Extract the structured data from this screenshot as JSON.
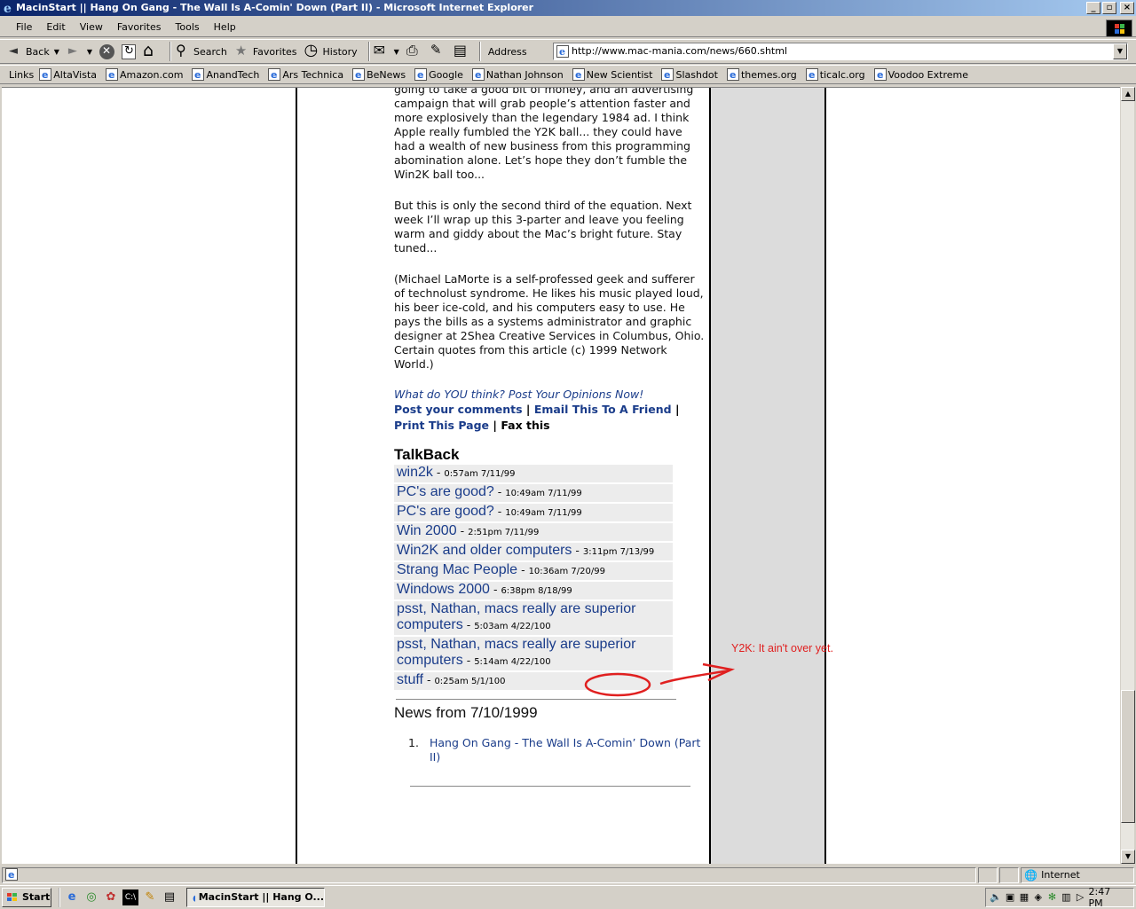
{
  "window": {
    "title": "MacinStart || Hang On Gang - The Wall Is A-Comin' Down (Part II) - Microsoft Internet Explorer"
  },
  "menu": [
    "File",
    "Edit",
    "View",
    "Favorites",
    "Tools",
    "Help"
  ],
  "toolbar": {
    "back": "Back",
    "search": "Search",
    "favorites": "Favorites",
    "history": "History",
    "address_label": "Address",
    "url": "http://www.mac-mania.com/news/660.shtml"
  },
  "links": {
    "label": "Links",
    "items": [
      "AltaVista",
      "Amazon.com",
      "AnandTech",
      "Ars Technica",
      "BeNews",
      "Google",
      "Nathan Johnson",
      "New Scientist",
      "Slashdot",
      "themes.org",
      "ticalc.org",
      "Voodoo Extreme"
    ]
  },
  "article": {
    "p1": "going to take a good bit of money, and an advertising campaign that will grab people’s attention faster and more explosively than the legendary 1984 ad. I think Apple really fumbled the Y2K ball... they could have had a wealth of new business from this programming abomination alone. Let’s hope they don’t fumble the Win2K ball too...",
    "p2": "But this is only the second third of the equation. Next week I’ll wrap up this 3-parter and leave you feeling warm and giddy about the Mac’s bright future. Stay tuned...",
    "p3": "(Michael LaMorte is a self-professed geek and sufferer of technolust syndrome. He likes his music played loud, his beer ice-cold, and his computers easy to use. He pays the bills as a systems administrator and graphic designer at 2Shea Creative Services in Columbus, Ohio. Certain quotes from this article (c) 1999 Network World.)",
    "opinions": "What do YOU think? Post Your Opinions Now!",
    "post_comments": "Post your comments",
    "email_friend": "Email This To A Friend",
    "print_page": "Print This Page",
    "fax": "Fax this",
    "sep": "|"
  },
  "talkback": {
    "title": "TalkBack",
    "dash": "-",
    "items": [
      {
        "title": "win2k",
        "date": "0:57am 7/11/99"
      },
      {
        "title": "PC's are good?",
        "date": "10:49am 7/11/99"
      },
      {
        "title": "PC's are good?",
        "date": "10:49am 7/11/99"
      },
      {
        "title": "Win 2000",
        "date": "2:51pm 7/11/99"
      },
      {
        "title": "Win2K and older computers",
        "date": "3:11pm 7/13/99"
      },
      {
        "title": "Strang Mac People",
        "date": "10:36am 7/20/99"
      },
      {
        "title": "Windows 2000",
        "date": "6:38pm 8/18/99"
      },
      {
        "title": "psst, Nathan, macs really are superior computers",
        "date": "5:03am 4/22/100"
      },
      {
        "title": "psst, Nathan, macs really are superior computers",
        "date": "5:14am 4/22/100"
      },
      {
        "title": "stuff",
        "date": "0:25am 5/1/100"
      }
    ]
  },
  "news": {
    "title": "News from 7/10/1999",
    "items": [
      {
        "num": "1.",
        "label": "Hang On Gang - The Wall Is A-Comin’ Down (Part II)"
      }
    ]
  },
  "annotation": {
    "text": "Y2K: It ain't over yet.",
    "color": "#e02020"
  },
  "status": {
    "zone": "Internet"
  },
  "taskbar": {
    "start": "Start",
    "task": "MacinStart || Hang O...",
    "clock": "2:47 PM"
  }
}
